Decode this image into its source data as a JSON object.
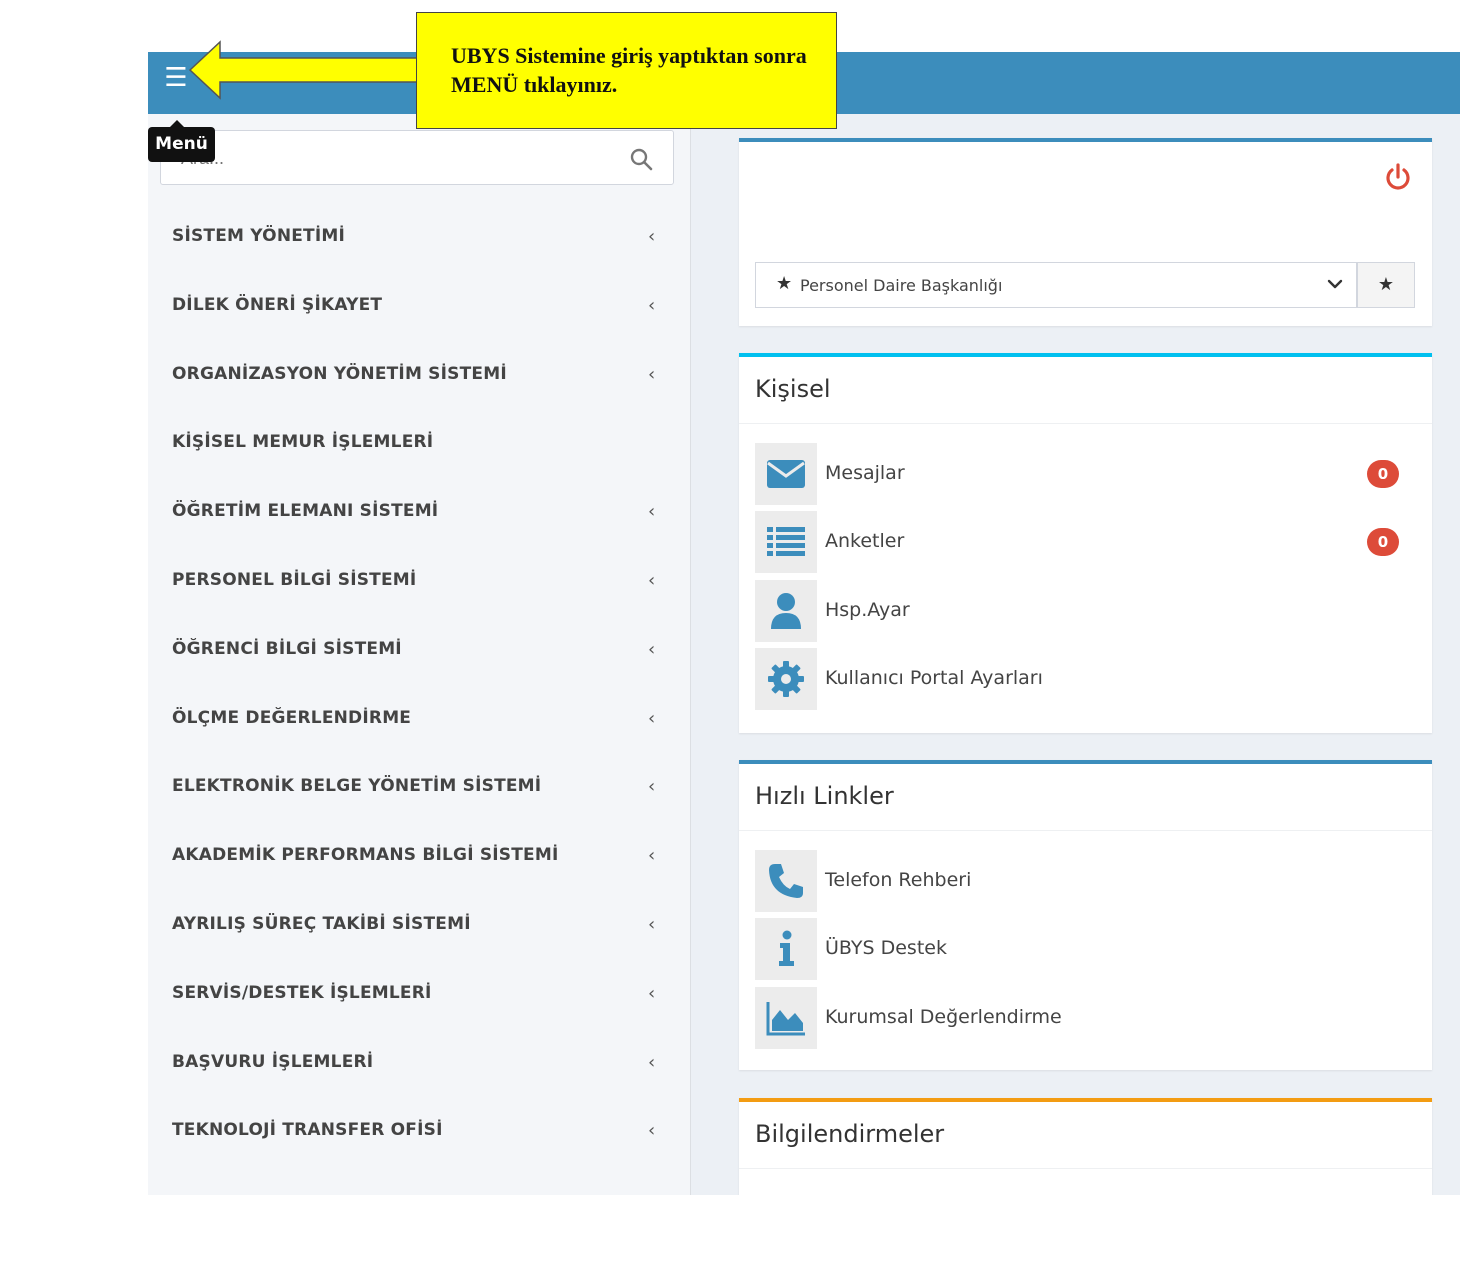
{
  "annotation": {
    "text": "UBYS Sistemine giriş yaptıktan sonra MENÜ tıklayınız."
  },
  "tooltip": {
    "label": "Menü"
  },
  "search": {
    "placeholder": "Ara..."
  },
  "sidebar": {
    "items": [
      {
        "label": "SİSTEM YÖNETİMİ",
        "has_children": true
      },
      {
        "label": "DİLEK ÖNERİ ŞİKAYET",
        "has_children": true
      },
      {
        "label": "ORGANİZASYON YÖNETİM SİSTEMİ",
        "has_children": true
      },
      {
        "label": "KİŞİSEL MEMUR İŞLEMLERİ",
        "has_children": false
      },
      {
        "label": "ÖĞRETİM ELEMANI SİSTEMİ",
        "has_children": true
      },
      {
        "label": "PERSONEL BİLGİ SİSTEMİ",
        "has_children": true
      },
      {
        "label": "ÖĞRENCİ BİLGİ SİSTEMİ",
        "has_children": true
      },
      {
        "label": "ÖLÇME DEĞERLENDİRME",
        "has_children": true
      },
      {
        "label": "ELEKTRONİK BELGE YÖNETİM SİSTEMİ",
        "has_children": true
      },
      {
        "label": "AKADEMİK PERFORMANS BİLGİ SİSTEMİ",
        "has_children": true
      },
      {
        "label": "AYRILIŞ SÜREÇ TAKİBİ SİSTEMİ",
        "has_children": true
      },
      {
        "label": "SERVİS/DESTEK İŞLEMLERİ",
        "has_children": true
      },
      {
        "label": "BAŞVURU İŞLEMLERİ",
        "has_children": true
      },
      {
        "label": "TEKNOLOJİ TRANSFER OFİSİ",
        "has_children": true
      }
    ],
    "chevron": "‹"
  },
  "profile": {
    "unit_selected": "Personel Daire Başkanlığı"
  },
  "personal": {
    "title": "Kişisel",
    "items": [
      {
        "label": "Mesajlar",
        "icon": "envelope-icon",
        "badge": "0"
      },
      {
        "label": "Anketler",
        "icon": "list-icon",
        "badge": "0"
      },
      {
        "label": "Hsp.Ayar",
        "icon": "user-icon"
      },
      {
        "label": "Kullanıcı Portal Ayarları",
        "icon": "gear-icon"
      }
    ]
  },
  "quick_links": {
    "title": "Hızlı Linkler",
    "items": [
      {
        "label": "Telefon Rehberi",
        "icon": "phone-icon"
      },
      {
        "label": "ÜBYS Destek",
        "icon": "info-icon"
      },
      {
        "label": "Kurumsal Değerlendirme",
        "icon": "area-chart-icon"
      }
    ]
  },
  "notifications": {
    "title": "Bilgilendirmeler"
  },
  "colors": {
    "header": "#3c8dbc",
    "box_profile": "#3c8dbc",
    "box_personal": "#00c0ef",
    "box_quick": "#3c8dbc",
    "box_notifications": "#f39c12",
    "icon_blue": "#3c8dbc",
    "badge_red": "#dd4b39",
    "annotation": "#ffff00"
  }
}
